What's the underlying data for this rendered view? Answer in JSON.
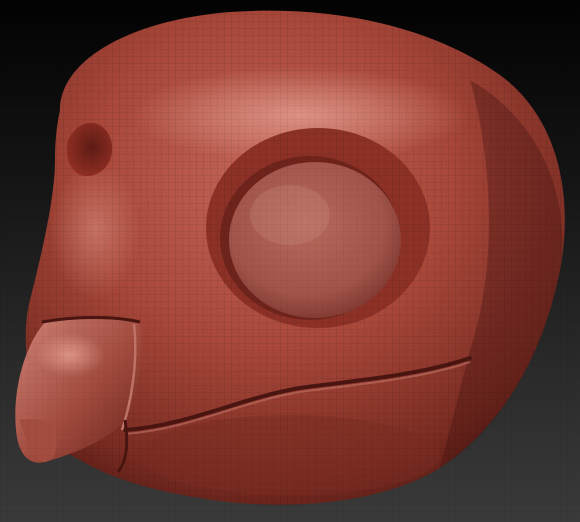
{
  "viewport": {
    "background_top": "#020202",
    "background_bottom": "#3a3a3a"
  },
  "model": {
    "material_color": "#a8473a",
    "highlight_color": "#d98a7c",
    "shadow_color": "#4a1510",
    "wireframe_visible": true
  }
}
